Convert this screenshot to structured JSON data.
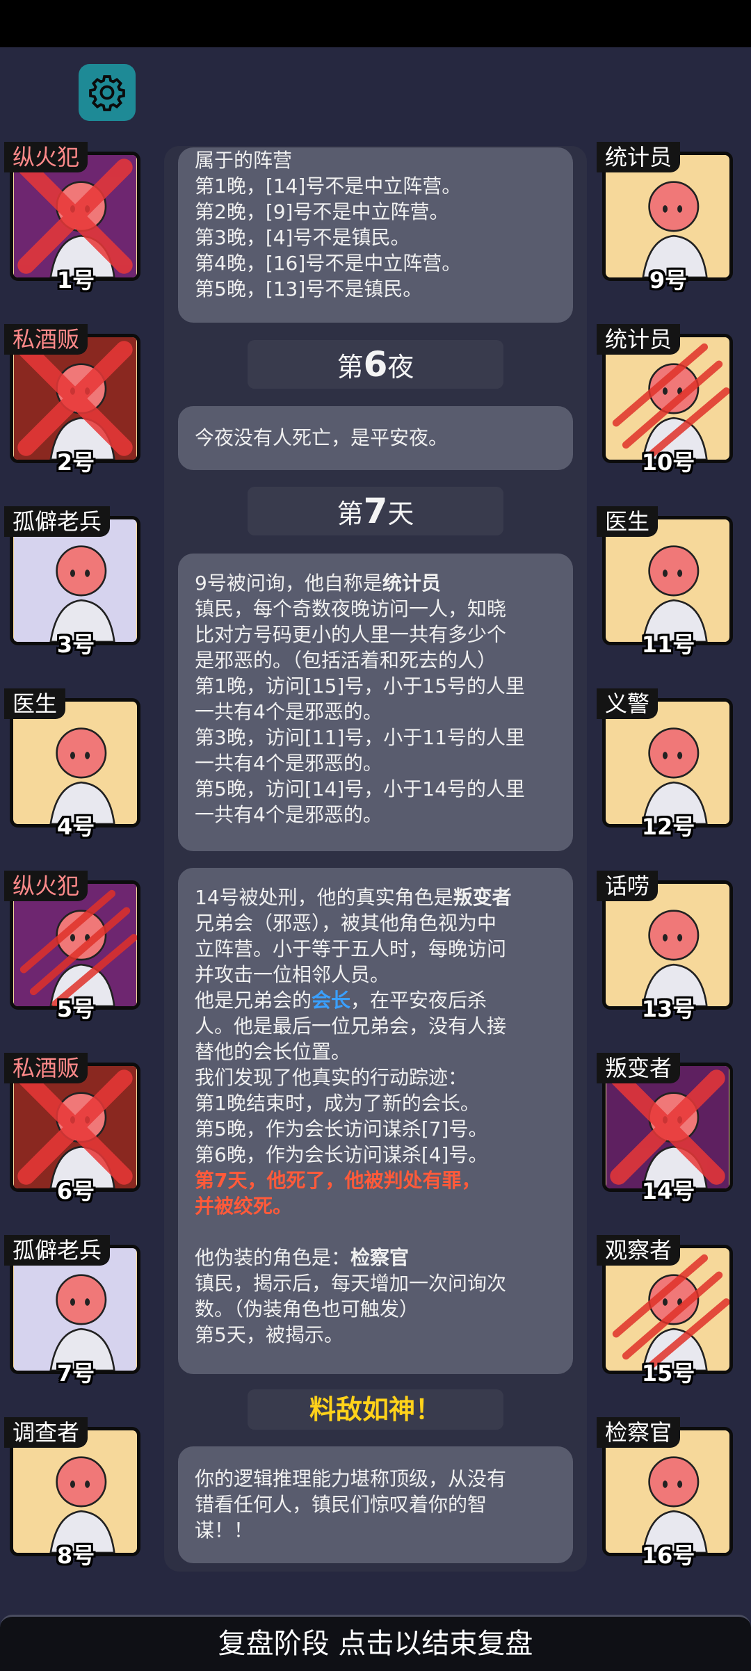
{
  "cards_left": [
    {
      "role": "纵火犯",
      "number": "1号",
      "label_color": "red",
      "bg": "#6e2670",
      "dead": "x"
    },
    {
      "role": "私酒贩",
      "number": "2号",
      "label_color": "red",
      "bg": "#8a2820",
      "dead": "x"
    },
    {
      "role": "孤僻老兵",
      "number": "3号",
      "label_color": "white",
      "bg": "#d6d3ee",
      "dead": "none"
    },
    {
      "role": "医生",
      "number": "4号",
      "label_color": "white",
      "bg": "#f6d89a",
      "dead": "none"
    },
    {
      "role": "纵火犯",
      "number": "5号",
      "label_color": "red",
      "bg": "#6e2670",
      "dead": "slash"
    },
    {
      "role": "私酒贩",
      "number": "6号",
      "label_color": "red",
      "bg": "#8a2820",
      "dead": "x"
    },
    {
      "role": "孤僻老兵",
      "number": "7号",
      "label_color": "white",
      "bg": "#d6d3ee",
      "dead": "none"
    },
    {
      "role": "调查者",
      "number": "8号",
      "label_color": "white",
      "bg": "#f6d89a",
      "dead": "none"
    }
  ],
  "cards_right": [
    {
      "role": "统计员",
      "number": "9号",
      "label_color": "white",
      "bg": "#f6d89a",
      "dead": "none"
    },
    {
      "role": "统计员",
      "number": "10号",
      "label_color": "white",
      "bg": "#f6d89a",
      "dead": "slash"
    },
    {
      "role": "医生",
      "number": "11号",
      "label_color": "white",
      "bg": "#f6d89a",
      "dead": "none"
    },
    {
      "role": "义警",
      "number": "12号",
      "label_color": "white",
      "bg": "#f6d89a",
      "dead": "none"
    },
    {
      "role": "话唠",
      "number": "13号",
      "label_color": "white",
      "bg": "#f6d89a",
      "dead": "none"
    },
    {
      "role": "叛变者",
      "number": "14号",
      "label_color": "white",
      "bg": "#5e2060",
      "dead": "x"
    },
    {
      "role": "观察者",
      "number": "15号",
      "label_color": "white",
      "bg": "#f6d89a",
      "dead": "slash"
    },
    {
      "role": "检察官",
      "number": "16号",
      "label_color": "white",
      "bg": "#f6d89a",
      "dead": "none"
    }
  ],
  "log": {
    "box1_lines": [
      "属于的阵营",
      "第1晚，[14]号不是中立阵营。",
      "第2晚，[9]号不是中立阵营。",
      "第3晚，[4]号不是镇民。",
      "第4晚，[16]号不是中立阵营。",
      "第5晚，[13]号不是镇民。"
    ],
    "night6_prefix": "第",
    "night6_num": "6",
    "night6_suffix": "夜",
    "box2_text": "今夜没有人死亡，是平安夜。",
    "day7_prefix": "第",
    "day7_num": "7",
    "day7_suffix": "天",
    "box3_first_a": "9号被问询，他自称是",
    "box3_first_b": "统计员",
    "box3_lines": [
      "镇民，每个奇数夜晚访问一人，知晓",
      "比对方号码更小的人里一共有多少个",
      "是邪恶的。（包括活着和死去的人）",
      "第1晚，访问[15]号，小于15号的人里",
      "一共有4个是邪恶的。",
      "第3晚，访问[11]号，小于11号的人里",
      "一共有4个是邪恶的。",
      "第5晚，访问[14]号，小于14号的人里",
      "一共有4个是邪恶的。"
    ],
    "box4_first_a": "14号被处刑，他的真实角色是",
    "box4_first_b": "叛变者",
    "box4_lines_a": [
      "兄弟会（邪恶），被其他角色视为中",
      "立阵营。小于等于五人时，每晚访问",
      "并攻击一位相邻人员。"
    ],
    "box4_leader_a": "他是兄弟会的",
    "box4_leader_b": "会长",
    "box4_leader_c": "，在平安夜后杀",
    "box4_lines_b": [
      "人。他是最后一位兄弟会，没有人接",
      "替他的会长位置。",
      "我们发现了他真实的行动踪迹：",
      "第1晚结束时，成为了新的会长。",
      "第5晚，作为会长访问谋杀[7]号。",
      "第6晚，作为会长访问谋杀[4]号。"
    ],
    "box4_red_lines": [
      "第7天，他死了，他被判处有罪，",
      "并被绞死。"
    ],
    "box4_disguise_a": "他伪装的角色是：",
    "box4_disguise_b": "检察官",
    "box4_lines_c": [
      "镇民，揭示后，每天增加一次问询次",
      "数。（伪装角色也可触发）",
      "第5天，被揭示。"
    ],
    "title_result": "料敌如神！",
    "box5_lines": [
      "你的逻辑推理能力堪称顶级，从没有",
      "错看任何人，镇民们惊叹着你的智",
      "谋！！"
    ]
  },
  "bottom_bar": "复盘阶段 点击以结束复盘",
  "icons": {
    "settings": "gear-icon"
  },
  "colors": {
    "background": "#262840",
    "box": "#595c6e",
    "accent_teal": "#1e8a96",
    "gold": "#ffd21a",
    "red_text": "#ff5a3a",
    "blue_text": "#3aa0ff"
  }
}
